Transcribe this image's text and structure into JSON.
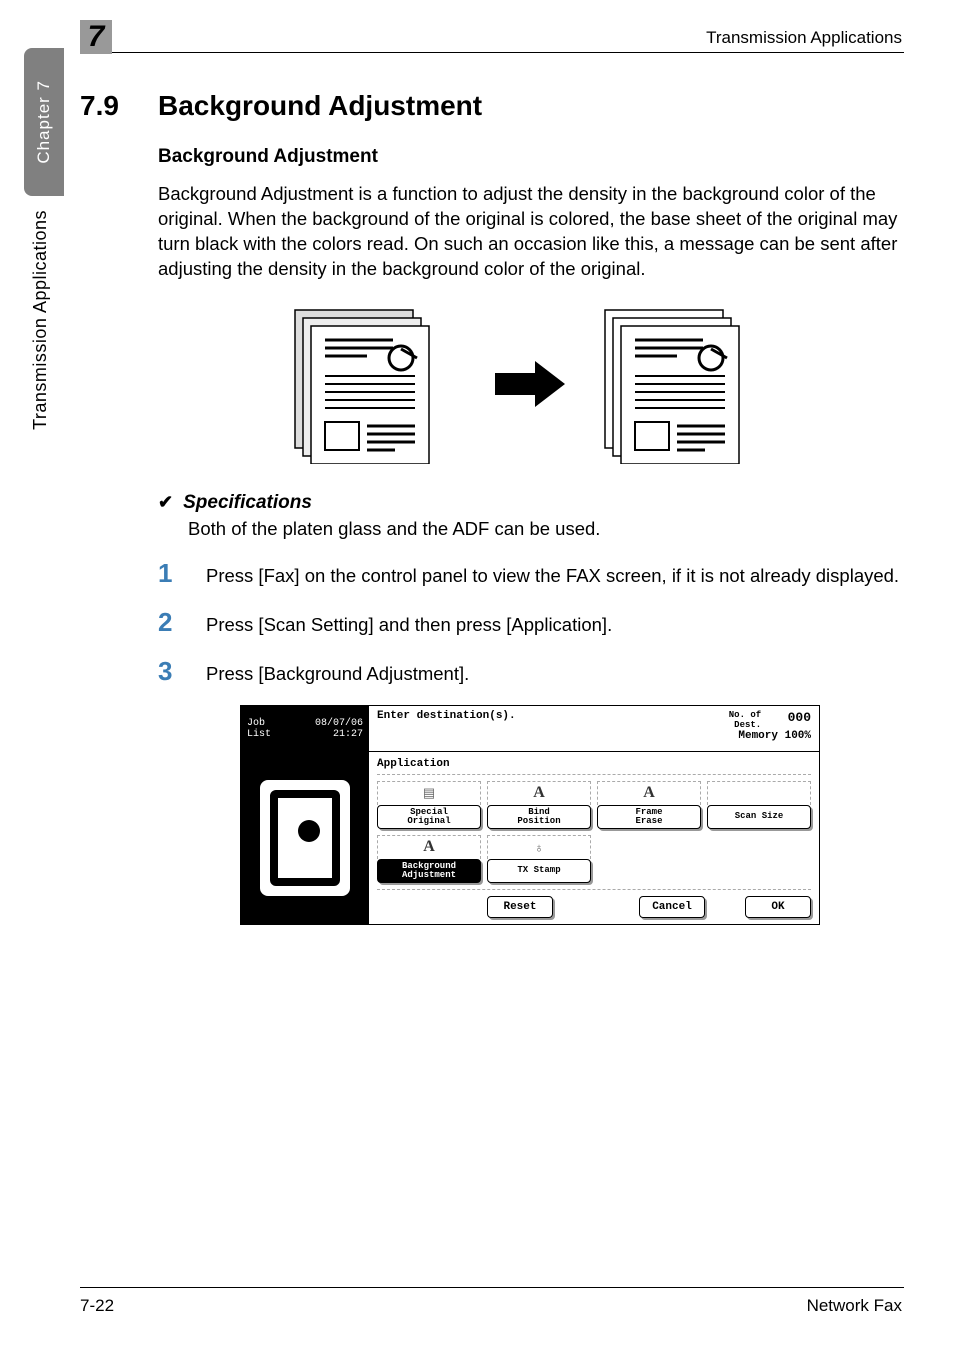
{
  "chapter_side_tab": "Chapter 7",
  "side_label": "Transmission Applications",
  "header_right": "Transmission Applications",
  "chapter_num_box": "7",
  "section_number": "7.9",
  "section_title": "Background Adjustment",
  "sub_heading": "Background Adjustment",
  "paragraph": "Background Adjustment is a function to adjust the density in the background color of the original. When the background of the original is colored, the base sheet of the original may turn black with the colors read. On such an occasion like this, a message can be sent after adjusting the density in the background color of the original.",
  "spec_title": "Specifications",
  "spec_body": "Both of the platen glass and the ADF can be used.",
  "steps": [
    "Press [Fax] on the control panel to view the FAX screen, if it is not already displayed.",
    "Press [Scan Setting] and then press [Application].",
    "Press [Background Adjustment]."
  ],
  "screenshot": {
    "job_list_label": "Job\nList",
    "date": "08/07/06",
    "time": "21:27",
    "enter_dest": "Enter destination(s).",
    "no_of_dest_label": "No. of\nDest.",
    "no_of_dest_value": "000",
    "memory_label": "Memory",
    "memory_value": "100%",
    "panel_label": "Application",
    "buttons": [
      {
        "label": "Special\nOriginal",
        "icon": "pages"
      },
      {
        "label": "Bind\nPosition",
        "icon": "A"
      },
      {
        "label": "Frame\nErase",
        "icon": "A"
      },
      {
        "label": "Scan Size",
        "icon": ""
      },
      {
        "label": "Background\nAdjustment",
        "icon": "A"
      },
      {
        "label": "TX Stamp",
        "icon": "stamp"
      }
    ],
    "footer": {
      "reset": "Reset",
      "cancel": "Cancel",
      "ok": "OK"
    }
  },
  "footer_left": "7-22",
  "footer_right": "Network Fax"
}
